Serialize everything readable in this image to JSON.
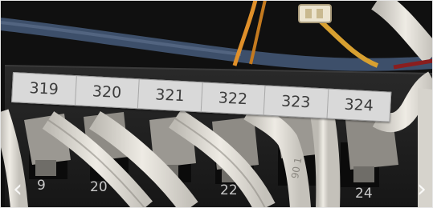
{
  "panel": {
    "labels": [
      "319",
      "320",
      "321",
      "322",
      "323",
      "324"
    ],
    "port_numbers": [
      "9",
      "20",
      "22",
      "24"
    ],
    "cable_print": "90 1"
  },
  "navigation": {
    "prev_icon": "chevron-left-icon",
    "next_icon": "chevron-right-icon",
    "prev_glyph": "‹",
    "next_glyph": "›"
  },
  "colors": {
    "background": "#121212",
    "label_strip": "#d9d9d9",
    "cable": "#e6e3dc",
    "boot": "#9b9892",
    "orange_wire": "#e0902a",
    "blue_cable": "#3d4f6a"
  }
}
